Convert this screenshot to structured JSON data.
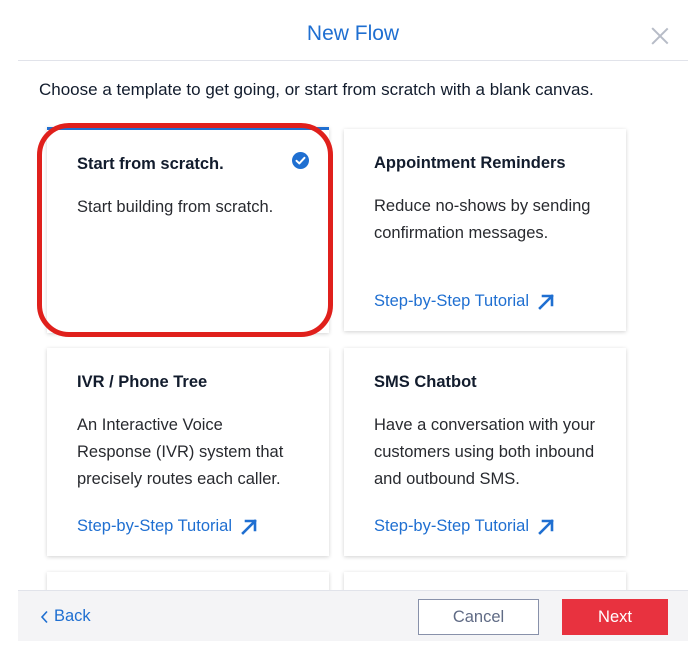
{
  "modal": {
    "title": "New Flow",
    "intro": "Choose a template to get going, or start from scratch with a blank canvas."
  },
  "templates": [
    {
      "title": "Start from scratch.",
      "description": "Start building from scratch.",
      "selected": true
    },
    {
      "title": "Appointment Reminders",
      "description": "Reduce no-shows by sending confirmation messages.",
      "tutorial": "Step-by-Step Tutorial"
    },
    {
      "title": "IVR / Phone Tree",
      "description": "An Interactive Voice Response (IVR) system that precisely routes each caller.",
      "tutorial": "Step-by-Step Tutorial"
    },
    {
      "title": "SMS Chatbot",
      "description": "Have a conversation with your customers using both inbound and outbound SMS.",
      "tutorial": "Step-by-Step Tutorial"
    }
  ],
  "footer": {
    "back_label": "Back",
    "cancel_label": "Cancel",
    "next_label": "Next"
  },
  "icons": {
    "close": "close-icon",
    "selected": "check-circle-icon",
    "tutorial_link": "arrow-up-right-icon",
    "back": "chevron-left-icon"
  },
  "colors": {
    "accent": "#1f6fd1",
    "primary_button": "#e8323f",
    "annotation_ring": "#e0201c"
  }
}
